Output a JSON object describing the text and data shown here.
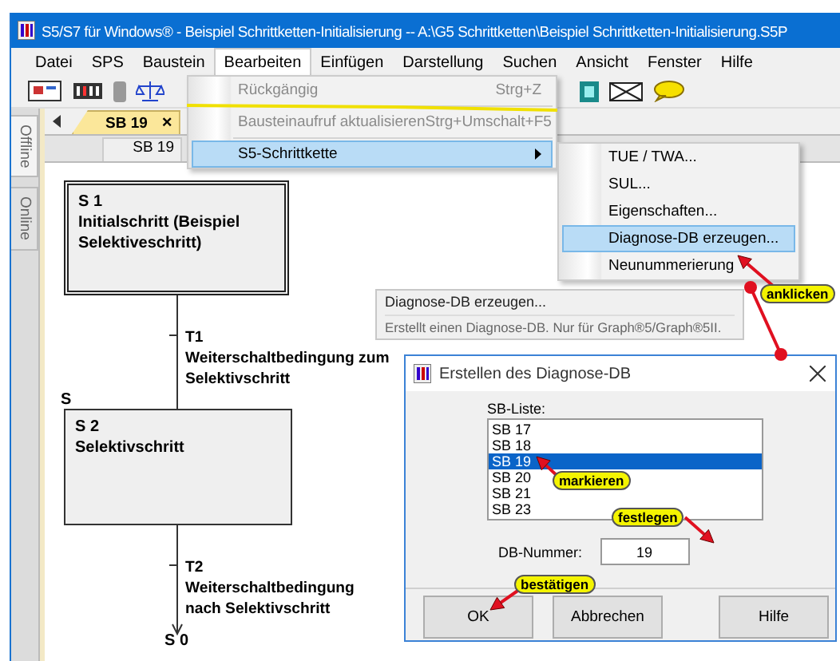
{
  "window": {
    "title": "S5/S7 für Windows® - Beispiel Schrittketten-Initialisierung -- A:\\G5 Schrittketten\\Beispiel Schrittketten-Initialisierung.S5P"
  },
  "menu_bar": [
    {
      "label": "Datei",
      "selected": false
    },
    {
      "label": "SPS",
      "selected": false
    },
    {
      "label": "Baustein",
      "selected": false
    },
    {
      "label": "Bearbeiten",
      "selected": true
    },
    {
      "label": "Einfügen",
      "selected": false
    },
    {
      "label": "Darstellung",
      "selected": false
    },
    {
      "label": "Suchen",
      "selected": false
    },
    {
      "label": "Ansicht",
      "selected": false
    },
    {
      "label": "Fenster",
      "selected": false
    },
    {
      "label": "Hilfe",
      "selected": false
    }
  ],
  "side_tabs": [
    {
      "label": "Offline",
      "selected": true
    },
    {
      "label": "Online",
      "selected": false
    }
  ],
  "tabs": [
    {
      "label": "SB 19",
      "selected": true,
      "close": "×"
    }
  ],
  "document": {
    "header": "SB 19",
    "steps": [
      {
        "name": "S 1",
        "text": "Initialschritt (Beispiel Selektiveschritt)",
        "initial": true
      },
      {
        "name": "S 2",
        "text": "Selektivschritt",
        "initial": false,
        "marker": "S"
      }
    ],
    "transitions": [
      {
        "name": "T1",
        "text": "Weiterschaltbedingung zum Selektivschritt"
      },
      {
        "name": "T2",
        "text": "Weiterschaltbedingung nach Selektivschritt"
      }
    ],
    "next_step": "S 0"
  },
  "edit_menu": {
    "items": [
      {
        "label": "Rückgängig",
        "shortcut": "Strg+Z",
        "disabled": true,
        "selected": false,
        "submenu": false
      },
      {
        "label": "Bausteinaufruf aktualisieren",
        "shortcut": "Strg+Umschalt+F5",
        "disabled": true,
        "selected": false,
        "submenu": false
      },
      {
        "label": "S5-Schrittkette",
        "disabled": false,
        "selected": true,
        "submenu": true
      }
    ]
  },
  "submenu": {
    "items": [
      {
        "label": "TUE / TWA...",
        "selected": false
      },
      {
        "label": "SUL...",
        "selected": false
      },
      {
        "label": "Eigenschaften...",
        "selected": false
      },
      {
        "label": "Diagnose-DB erzeugen...",
        "selected": true
      },
      {
        "label": "Neunummerierung",
        "selected": false
      }
    ]
  },
  "tooltip": {
    "title": "Diagnose-DB erzeugen...",
    "description": "Erstellt einen Diagnose-DB. Nur für Graph®5/Graph®5II."
  },
  "dialog": {
    "title": "Erstellen des Diagnose-DB",
    "list_label": "SB-Liste:",
    "list": [
      {
        "label": "SB 17",
        "selected": false
      },
      {
        "label": "SB 18",
        "selected": false
      },
      {
        "label": "SB 19",
        "selected": true
      },
      {
        "label": "SB 20",
        "selected": false
      },
      {
        "label": "SB 21",
        "selected": false
      },
      {
        "label": "SB 23",
        "selected": false
      }
    ],
    "field_label": "DB-Nummer:",
    "field_value": "19",
    "buttons": [
      "OK",
      "Abbrechen",
      "Hilfe"
    ]
  },
  "annotations": [
    {
      "text": "anklicken"
    },
    {
      "text": "markieren"
    },
    {
      "text": "festlegen"
    },
    {
      "text": "bestätigen"
    }
  ]
}
